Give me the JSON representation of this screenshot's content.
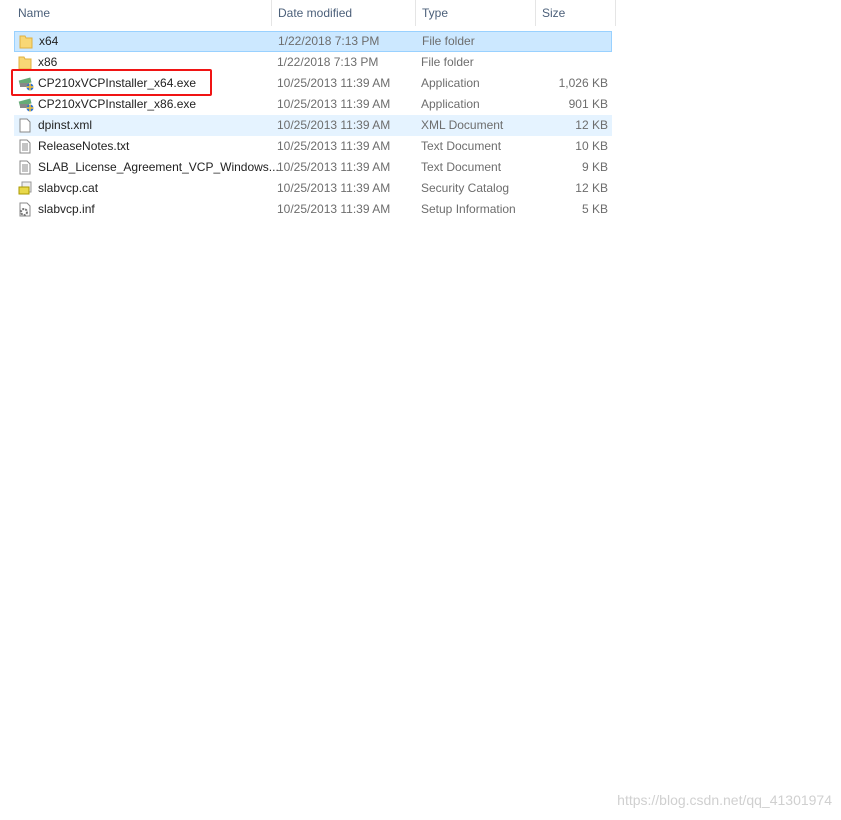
{
  "columns": {
    "name": "Name",
    "date": "Date modified",
    "type": "Type",
    "size": "Size"
  },
  "files": [
    {
      "name": "x64",
      "date": "1/22/2018 7:13 PM",
      "type": "File folder",
      "size": "",
      "icon": "folder-icon",
      "state": "selected"
    },
    {
      "name": "x86",
      "date": "1/22/2018 7:13 PM",
      "type": "File folder",
      "size": "",
      "icon": "folder-icon",
      "state": ""
    },
    {
      "name": "CP210xVCPInstaller_x64.exe",
      "date": "10/25/2013 11:39 AM",
      "type": "Application",
      "size": "1,026 KB",
      "icon": "installer-icon",
      "state": "highlighted"
    },
    {
      "name": "CP210xVCPInstaller_x86.exe",
      "date": "10/25/2013 11:39 AM",
      "type": "Application",
      "size": "901 KB",
      "icon": "installer-icon",
      "state": ""
    },
    {
      "name": "dpinst.xml",
      "date": "10/25/2013 11:39 AM",
      "type": "XML Document",
      "size": "12 KB",
      "icon": "document-icon",
      "state": "hover"
    },
    {
      "name": "ReleaseNotes.txt",
      "date": "10/25/2013 11:39 AM",
      "type": "Text Document",
      "size": "10 KB",
      "icon": "text-file-icon",
      "state": ""
    },
    {
      "name": "SLAB_License_Agreement_VCP_Windows...",
      "date": "10/25/2013 11:39 AM",
      "type": "Text Document",
      "size": "9 KB",
      "icon": "text-file-icon",
      "state": ""
    },
    {
      "name": "slabvcp.cat",
      "date": "10/25/2013 11:39 AM",
      "type": "Security Catalog",
      "size": "12 KB",
      "icon": "catalog-icon",
      "state": ""
    },
    {
      "name": "slabvcp.inf",
      "date": "10/25/2013 11:39 AM",
      "type": "Setup Information",
      "size": "5 KB",
      "icon": "setup-info-icon",
      "state": ""
    }
  ],
  "watermark": "https://blog.csdn.net/qq_41301974",
  "colors": {
    "selected": "#cce8ff",
    "hover": "#e5f3ff",
    "highlight_box": "#f01414"
  }
}
